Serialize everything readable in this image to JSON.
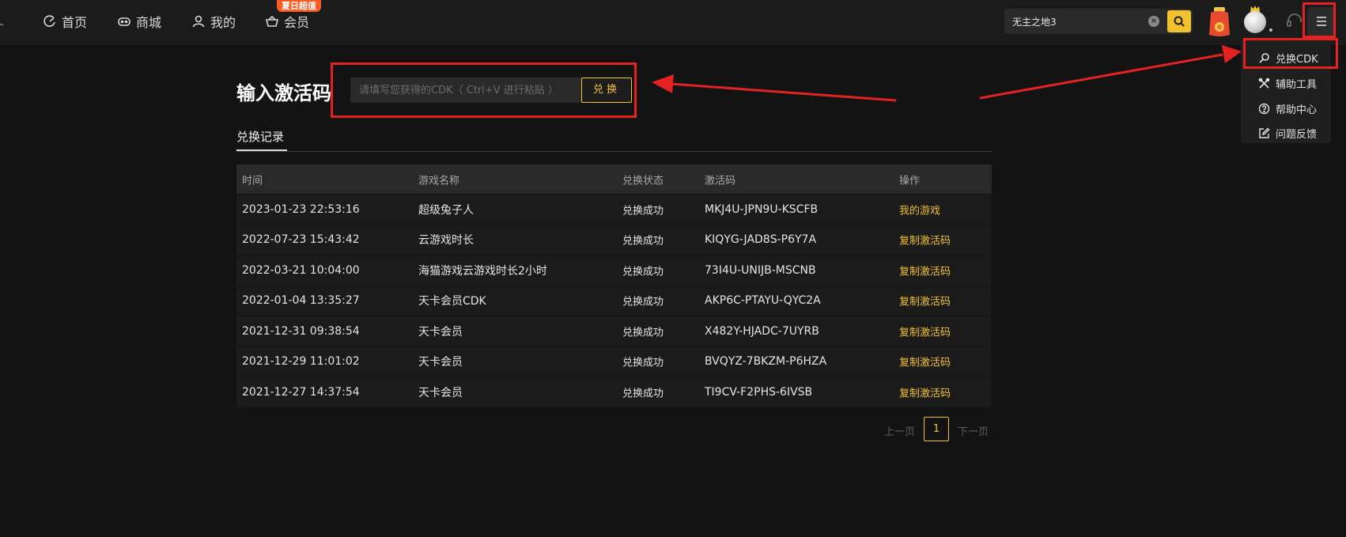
{
  "colors": {
    "accent": "#f2c12e",
    "highlight": "#e52222",
    "promo": "#ff5a1f",
    "background": "#131313"
  },
  "nav": {
    "home": {
      "label": "首页",
      "icon": "home-icon"
    },
    "store": {
      "label": "商城",
      "icon": "gamepad-icon"
    },
    "mine": {
      "label": "我的",
      "icon": "user-icon"
    },
    "vip": {
      "label": "会员",
      "icon": "basket-icon",
      "badge": "夏日超值"
    }
  },
  "search": {
    "value": "无主之地3",
    "icon": "search-icon"
  },
  "menu": {
    "icon": "hamburger-icon",
    "items": [
      {
        "label": "兑换CDK",
        "icon": "search-icon"
      },
      {
        "label": "辅助工具",
        "icon": "tools-icon"
      },
      {
        "label": "帮助中心",
        "icon": "help-icon"
      },
      {
        "label": "问题反馈",
        "icon": "edit-icon"
      }
    ]
  },
  "redeem": {
    "title": "输入激活码",
    "placeholder": "请填写您获得的CDK（ Ctrl+V 进行粘贴 ）",
    "button": "兑换"
  },
  "tabs": {
    "record": "兑换记录"
  },
  "table": {
    "headers": {
      "time": "时间",
      "game": "游戏名称",
      "status": "兑换状态",
      "code": "激活码",
      "op": "操作"
    },
    "rows": [
      {
        "time": "2023-01-23 22:53:16",
        "game": "超级兔子人",
        "status": "兑换成功",
        "code": "MKJ4U-JPN9U-KSCFB",
        "op": "我的游戏"
      },
      {
        "time": "2022-07-23 15:43:42",
        "game": "云游戏时长",
        "status": "兑换成功",
        "code": "KIQYG-JAD8S-P6Y7A",
        "op": "复制激活码"
      },
      {
        "time": "2022-03-21 10:04:00",
        "game": "海猫游戏云游戏时长2小时",
        "status": "兑换成功",
        "code": "73I4U-UNIJB-MSCNB",
        "op": "复制激活码"
      },
      {
        "time": "2022-01-04 13:35:27",
        "game": "天卡会员CDK",
        "status": "兑换成功",
        "code": "AKP6C-PTAYU-QYC2A",
        "op": "复制激活码"
      },
      {
        "time": "2021-12-31 09:38:54",
        "game": "天卡会员",
        "status": "兑换成功",
        "code": "X482Y-HJADC-7UYRB",
        "op": "复制激活码"
      },
      {
        "time": "2021-12-29 11:01:02",
        "game": "天卡会员",
        "status": "兑换成功",
        "code": "BVQYZ-7BKZM-P6HZA",
        "op": "复制激活码"
      },
      {
        "time": "2021-12-27 14:37:54",
        "game": "天卡会员",
        "status": "兑换成功",
        "code": "TI9CV-F2PHS-6IVSB",
        "op": "复制激活码"
      }
    ]
  },
  "pagination": {
    "prev": "上一页",
    "current": "1",
    "next": "下一页"
  }
}
